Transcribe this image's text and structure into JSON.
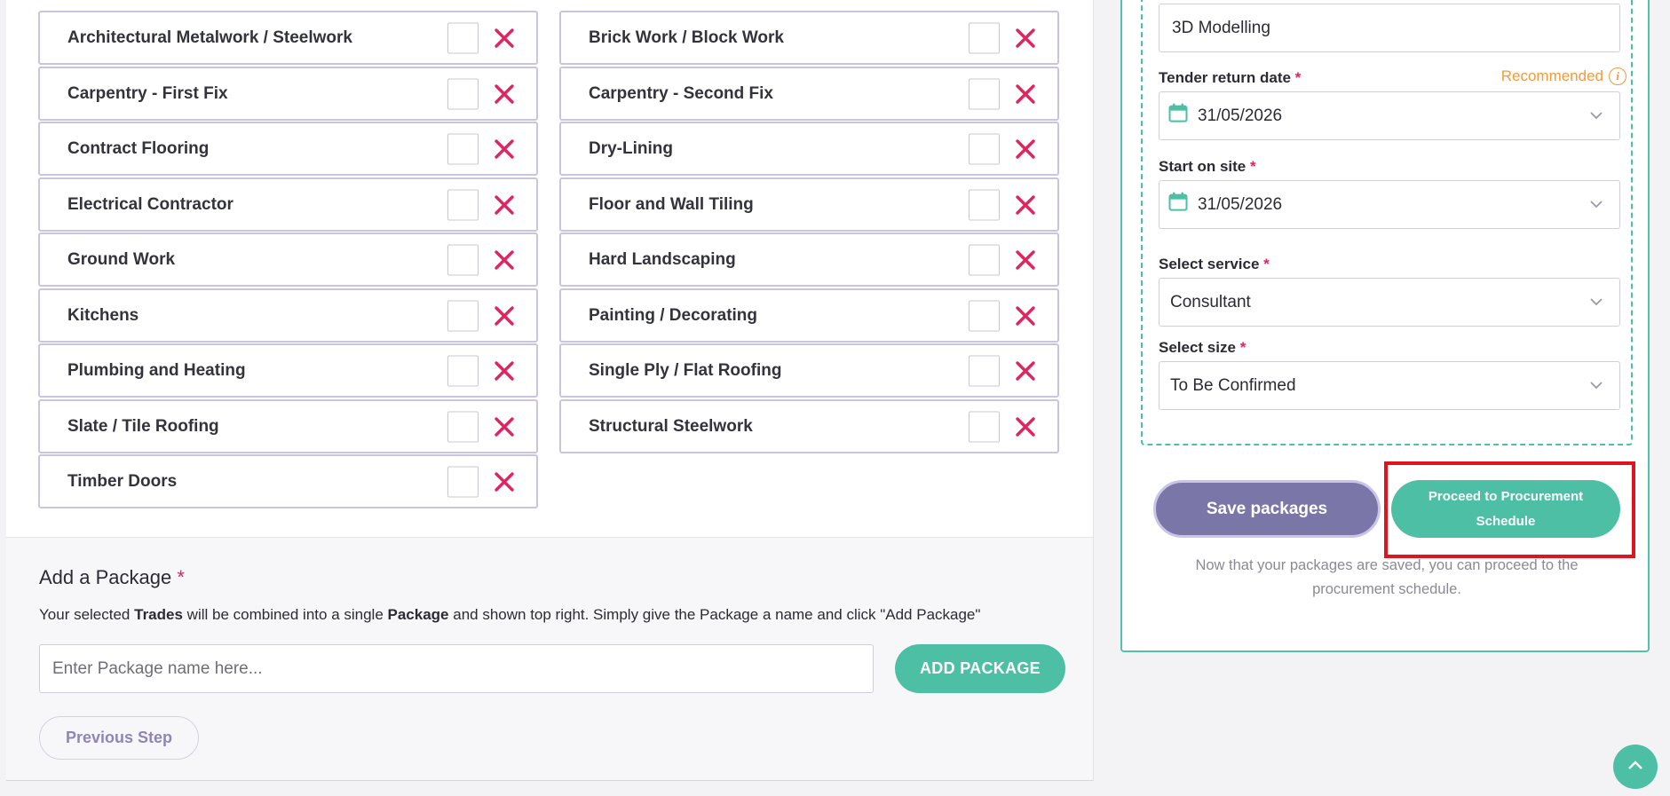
{
  "trades": {
    "left": [
      {
        "label": "Architectural Metalwork / Steelwork"
      },
      {
        "label": "Carpentry - First Fix"
      },
      {
        "label": "Contract Flooring"
      },
      {
        "label": "Electrical Contractor"
      },
      {
        "label": "Ground Work"
      },
      {
        "label": "Kitchens"
      },
      {
        "label": "Plumbing and Heating"
      },
      {
        "label": "Slate / Tile Roofing"
      },
      {
        "label": "Timber Doors"
      }
    ],
    "right": [
      {
        "label": "Brick Work / Block Work"
      },
      {
        "label": "Carpentry - Second Fix"
      },
      {
        "label": "Dry-Lining"
      },
      {
        "label": "Floor and Wall Tiling"
      },
      {
        "label": "Hard Landscaping"
      },
      {
        "label": "Painting / Decorating"
      },
      {
        "label": "Single Ply / Flat Roofing"
      },
      {
        "label": "Structural Steelwork"
      }
    ]
  },
  "add_package": {
    "title": "Add a Package",
    "required_mark": "*",
    "desc_1": "Your selected ",
    "desc_trades": "Trades",
    "desc_2": " will be combined into a single ",
    "desc_package": "Package",
    "desc_3": " and shown top right. Simply give the Package a name and click \"Add Package\"",
    "input_value": "",
    "input_placeholder": "Enter Package name here...",
    "button_label": "ADD PACKAGE",
    "previous_label": "Previous Step"
  },
  "sidebar": {
    "package_name": "3D Modelling",
    "tender_label": "Tender return date",
    "recommended_label": "Recommended",
    "tender_value": "31/05/2026",
    "start_label": "Start on site",
    "start_value": "31/05/2026",
    "service_label": "Select service",
    "service_value": "Consultant",
    "size_label": "Select size",
    "size_value": "To Be Confirmed",
    "required_mark": "*",
    "save_label": "Save packages",
    "proceed_label": "Proceed to Procurement Schedule",
    "note": "Now that your packages are saved, you can proceed to the procurement schedule."
  },
  "colors": {
    "accent_teal": "#4dbfa5",
    "accent_purple": "#7b76a8",
    "remove_red": "#e0245e",
    "recommended_orange": "#f39a3b",
    "highlight_red": "#e0141e"
  },
  "icons": {
    "remove": "close-x-icon",
    "calendar": "calendar-icon",
    "chevron": "chevron-down-icon",
    "info": "info-icon",
    "scroll_top": "chevron-up-icon"
  }
}
